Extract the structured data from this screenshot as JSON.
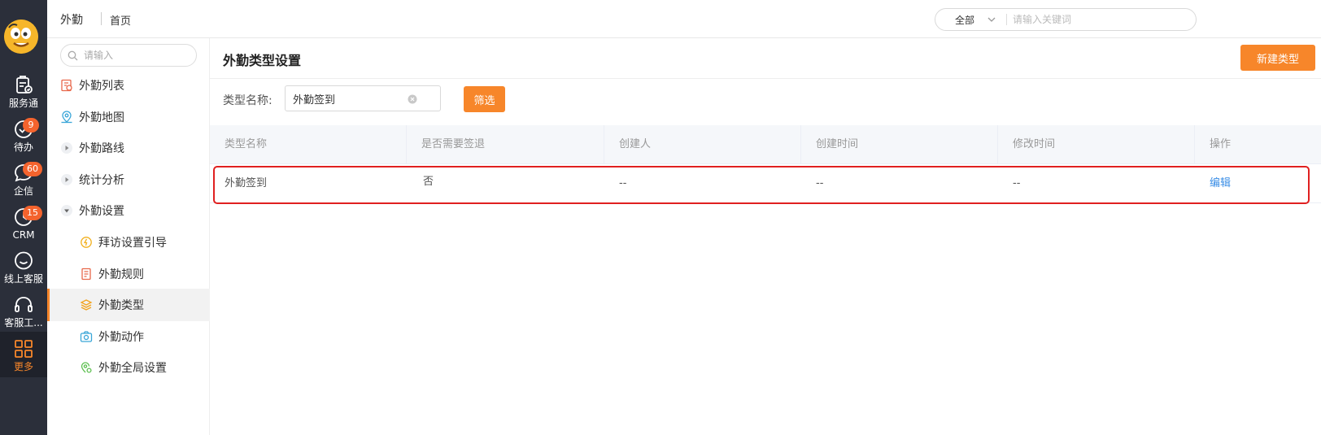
{
  "rail": {
    "items": [
      {
        "label": "服务通"
      },
      {
        "label": "待办",
        "badge": "9"
      },
      {
        "label": "企信",
        "badge": "60"
      },
      {
        "label": "CRM",
        "badge": "15"
      },
      {
        "label": "线上客服"
      },
      {
        "label": "客服工..."
      },
      {
        "label": "更多"
      }
    ]
  },
  "header": {
    "app_name": "外勤",
    "breadcrumb": "首页",
    "search": {
      "scope": "全部",
      "placeholder": "请输入关键词"
    }
  },
  "sidebar": {
    "search_placeholder": "请输入",
    "items": [
      {
        "label": "外勤列表"
      },
      {
        "label": "外勤地图"
      },
      {
        "label": "外勤路线"
      },
      {
        "label": "统计分析"
      },
      {
        "label": "外勤设置"
      },
      {
        "label": "拜访设置引导"
      },
      {
        "label": "外勤规则"
      },
      {
        "label": "外勤类型"
      },
      {
        "label": "外勤动作"
      },
      {
        "label": "外勤全局设置"
      }
    ]
  },
  "main": {
    "title": "外勤类型设置",
    "new_button": "新建类型",
    "filter": {
      "label": "类型名称:",
      "value": "外勤签到",
      "button": "筛选"
    },
    "table": {
      "columns": [
        "类型名称",
        "是否需要签退",
        "创建人",
        "创建时间",
        "修改时间",
        "操作"
      ],
      "rows": [
        {
          "name": "外勤签到",
          "need_signout": "否",
          "creator": "--",
          "created": "--",
          "modified": "--",
          "action": "编辑"
        }
      ]
    }
  },
  "colors": {
    "accent": "#f7862a",
    "rail_bg": "#2b2f3a",
    "badge": "#f4632d",
    "link": "#3a8ee6",
    "highlight": "#e02020"
  }
}
